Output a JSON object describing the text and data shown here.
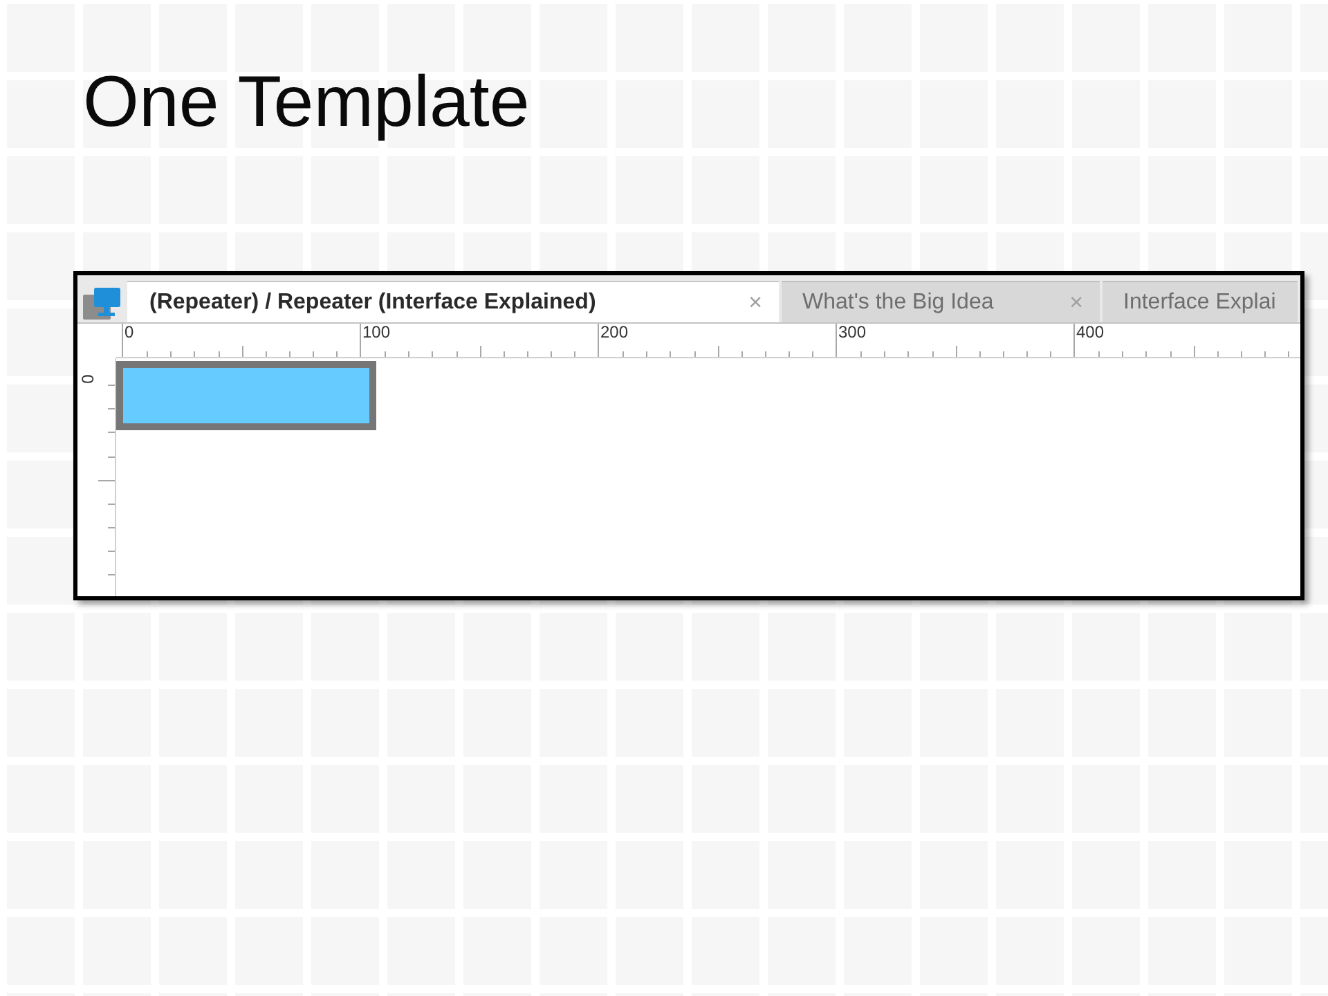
{
  "slide": {
    "title": "One Template"
  },
  "editor": {
    "tabs": [
      {
        "label": "(Repeater) / Repeater (Interface Explained)",
        "close": "×",
        "selected": true
      },
      {
        "label": "What's the Big Idea",
        "close": "×",
        "selected": false
      },
      {
        "label": "Interface Explai",
        "selected": false
      }
    ],
    "horizontal_ruler": {
      "labels": [
        "0",
        "100",
        "200",
        "300",
        "400"
      ]
    },
    "vertical_ruler": {
      "labels": [
        "0"
      ]
    }
  }
}
